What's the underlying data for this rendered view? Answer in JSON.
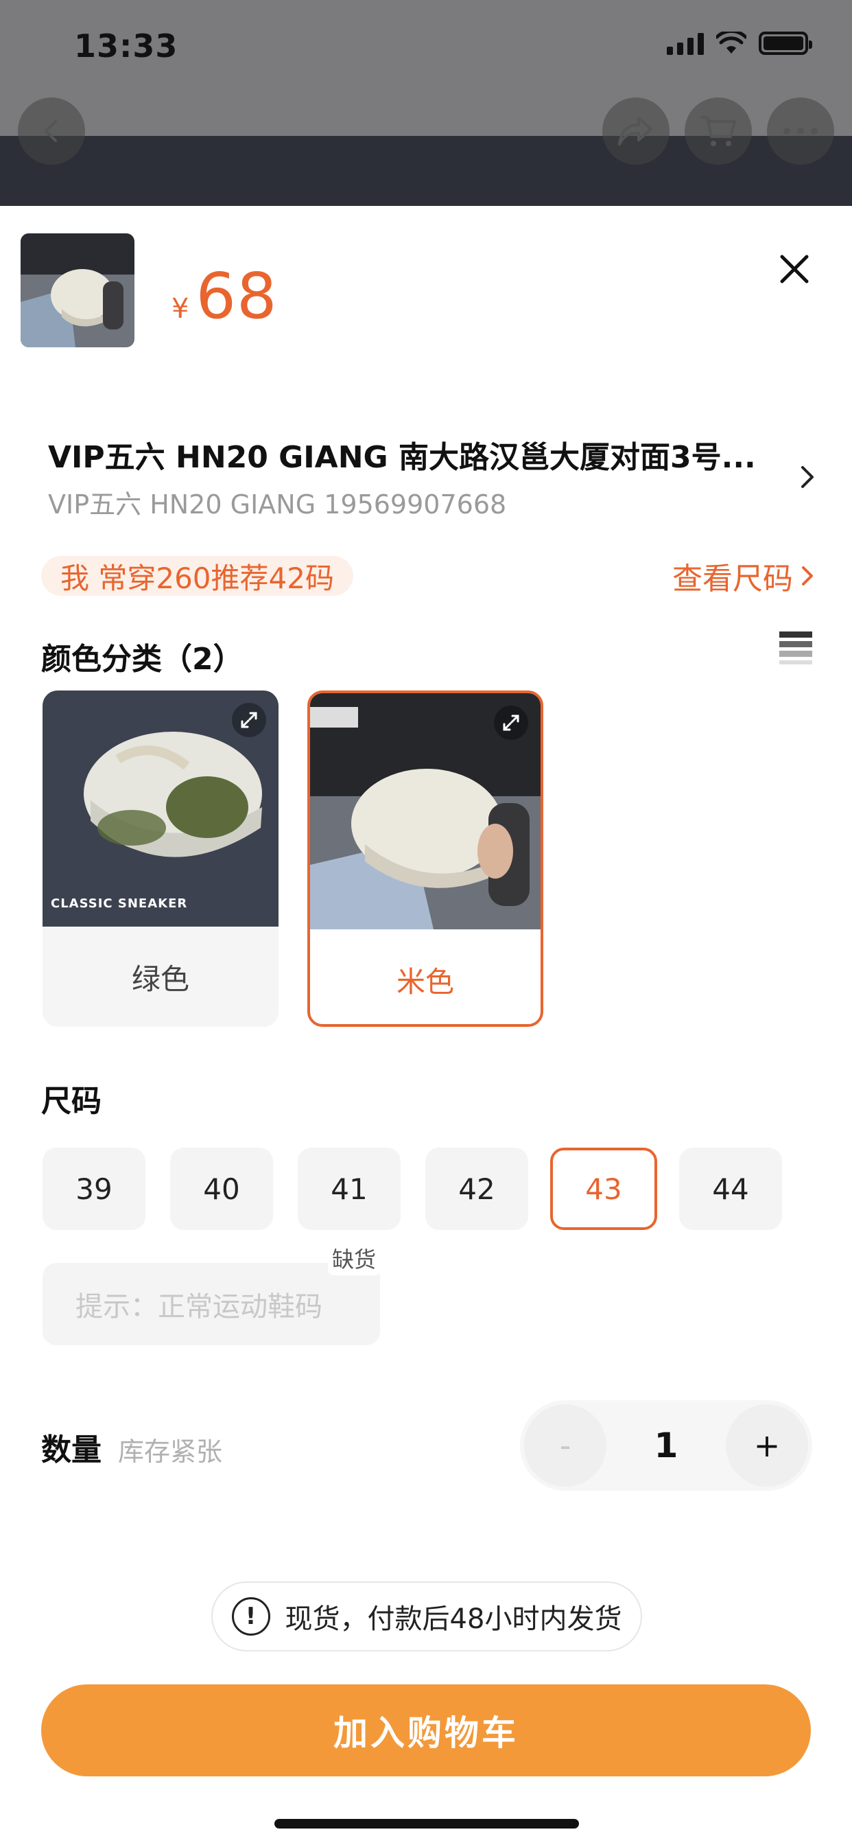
{
  "status": {
    "time": "13:33"
  },
  "nav": {
    "back": "chevron-left-icon",
    "share": "share-icon",
    "cart": "cart-icon",
    "more": "more-icon"
  },
  "product": {
    "currency": "¥",
    "price": "68"
  },
  "shop": {
    "title": "VIP五六 HN20 GIANG   南大路汉邕大厦对面3号...",
    "subtitle": "VIP五六   HN20 GIANG 19569907668"
  },
  "recommend": {
    "text": "我  常穿260推荐42码",
    "link": "查看尺码 "
  },
  "color_section": {
    "title": "颜色分类（2）",
    "options": [
      {
        "label": "绿色",
        "selected": false,
        "image_caption": "CLASSIC SNEAKER"
      },
      {
        "label": "米色",
        "selected": true
      }
    ]
  },
  "size_section": {
    "title": "尺码",
    "options": [
      {
        "label": "39",
        "selected": false
      },
      {
        "label": "40",
        "selected": false
      },
      {
        "label": "41",
        "selected": false
      },
      {
        "label": "42",
        "selected": false
      },
      {
        "label": "43",
        "selected": true
      },
      {
        "label": "44",
        "selected": false
      }
    ],
    "out_of_stock": "缺货",
    "hint": "提示：正常运动鞋码"
  },
  "quantity": {
    "label": "数量",
    "stock_note": "库存紧张",
    "value": "1",
    "minus": "-",
    "plus": "+"
  },
  "notice": {
    "text": "现货，付款后48小时内发货"
  },
  "cart_button": {
    "label": "加入购物车"
  },
  "colors": {
    "accent": "#e8652f",
    "button": "#f3993a"
  }
}
